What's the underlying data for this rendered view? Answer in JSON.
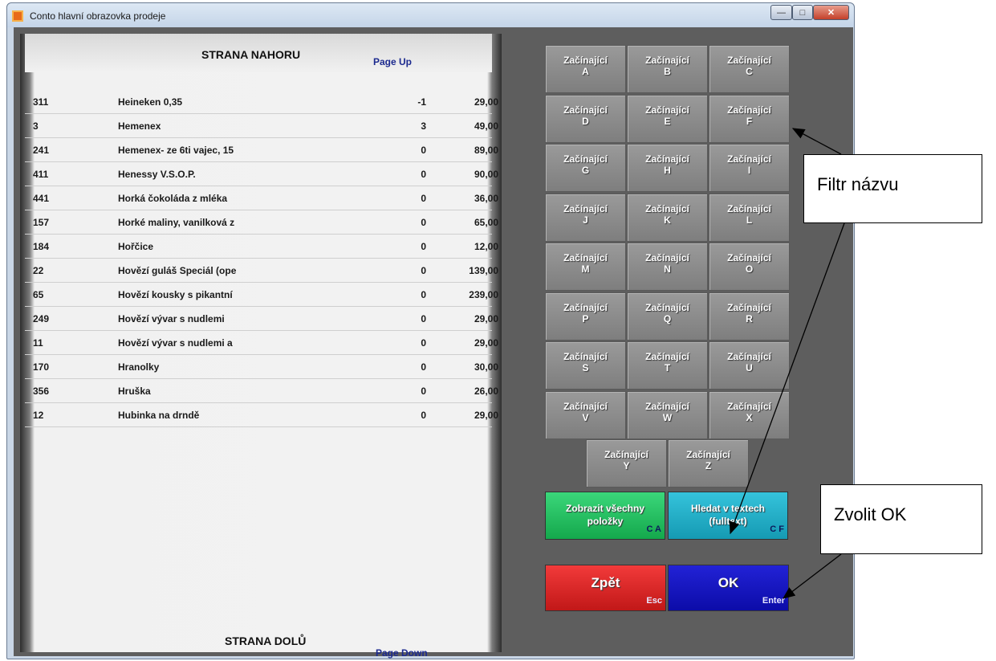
{
  "window": {
    "title": "Conto hlavní obrazovka prodeje"
  },
  "list": {
    "page_up_label": "STRANA NAHORU",
    "page_up_key": "Page Up",
    "page_down_label": "STRANA DOLŮ",
    "page_down_key": "Page Down",
    "rows": [
      {
        "code": "311",
        "name": "Heineken 0,35",
        "qty": "-1",
        "price": "29,00"
      },
      {
        "code": "3",
        "name": "Hemenex",
        "qty": "3",
        "price": "49,00"
      },
      {
        "code": "241",
        "name": "Hemenex- ze 6ti vajec, 15",
        "qty": "0",
        "price": "89,00"
      },
      {
        "code": "411",
        "name": "Henessy V.S.O.P.",
        "qty": "0",
        "price": "90,00"
      },
      {
        "code": "441",
        "name": "Horká čokoláda z mléka",
        "qty": "0",
        "price": "36,00"
      },
      {
        "code": "157",
        "name": "Horké maliny, vanilková z",
        "qty": "0",
        "price": "65,00"
      },
      {
        "code": "184",
        "name": "Hořčice",
        "qty": "0",
        "price": "12,00"
      },
      {
        "code": "22",
        "name": "Hovězí guláš Speciál (ope",
        "qty": "0",
        "price": "139,00"
      },
      {
        "code": "65",
        "name": "Hovězí kousky s pikantní",
        "qty": "0",
        "price": "239,00"
      },
      {
        "code": "249",
        "name": "Hovězí vývar s nudlemi",
        "qty": "0",
        "price": "29,00"
      },
      {
        "code": "11",
        "name": "Hovězí vývar s nudlemi a",
        "qty": "0",
        "price": "29,00"
      },
      {
        "code": "170",
        "name": "Hranolky",
        "qty": "0",
        "price": "30,00"
      },
      {
        "code": "356",
        "name": "Hruška",
        "qty": "0",
        "price": "26,00"
      },
      {
        "code": "12",
        "name": "Hubinka na drndě",
        "qty": "0",
        "price": "29,00"
      }
    ]
  },
  "filter": {
    "prefix": "Začínající",
    "letters": [
      "A",
      "B",
      "C",
      "D",
      "E",
      "F",
      "G",
      "H",
      "I",
      "J",
      "K",
      "L",
      "M",
      "N",
      "O",
      "P",
      "Q",
      "R",
      "S",
      "T",
      "U",
      "V",
      "W",
      "X",
      "Y",
      "Z"
    ]
  },
  "actions": {
    "show_all": {
      "label": "Zobrazit všechny položky",
      "key": "C A"
    },
    "fulltext": {
      "label": "Hledat v textech (fulltext)",
      "key": "C F"
    },
    "back": {
      "label": "Zpět",
      "key": "Esc"
    },
    "ok": {
      "label": "OK",
      "key": "Enter"
    }
  },
  "callouts": {
    "filter": "Filtr názvu",
    "ok": "Zvolit OK"
  },
  "colors": {
    "show_all": "#14a84c",
    "fulltext": "#159ab3",
    "back": "#c11818",
    "ok": "#0c0ca8"
  }
}
